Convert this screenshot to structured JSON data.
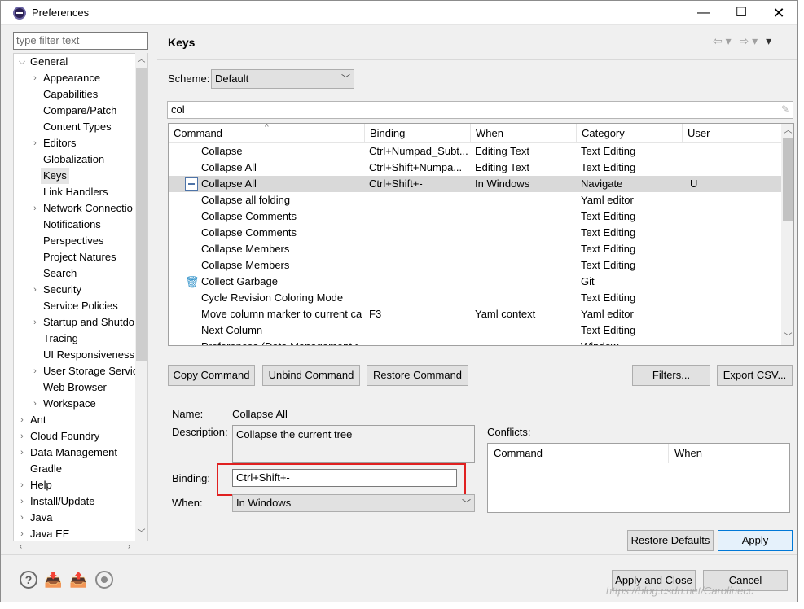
{
  "window": {
    "title": "Preferences",
    "minimize": "—",
    "maximize": "☐",
    "close": "✕"
  },
  "filter": {
    "placeholder": "type filter text"
  },
  "tree": {
    "items": [
      {
        "label": "General",
        "arrow": "⌵",
        "indent": 0
      },
      {
        "label": "Appearance",
        "arrow": "›",
        "indent": 1
      },
      {
        "label": "Capabilities",
        "arrow": "",
        "indent": 1
      },
      {
        "label": "Compare/Patch",
        "arrow": "",
        "indent": 1
      },
      {
        "label": "Content Types",
        "arrow": "",
        "indent": 1
      },
      {
        "label": "Editors",
        "arrow": "›",
        "indent": 1
      },
      {
        "label": "Globalization",
        "arrow": "",
        "indent": 1
      },
      {
        "label": "Keys",
        "arrow": "",
        "indent": 1
      },
      {
        "label": "Link Handlers",
        "arrow": "",
        "indent": 1
      },
      {
        "label": "Network Connectio",
        "arrow": "›",
        "indent": 1
      },
      {
        "label": "Notifications",
        "arrow": "",
        "indent": 1
      },
      {
        "label": "Perspectives",
        "arrow": "",
        "indent": 1
      },
      {
        "label": "Project Natures",
        "arrow": "",
        "indent": 1
      },
      {
        "label": "Search",
        "arrow": "",
        "indent": 1
      },
      {
        "label": "Security",
        "arrow": "›",
        "indent": 1
      },
      {
        "label": "Service Policies",
        "arrow": "",
        "indent": 1
      },
      {
        "label": "Startup and Shutdo",
        "arrow": "›",
        "indent": 1
      },
      {
        "label": "Tracing",
        "arrow": "",
        "indent": 1
      },
      {
        "label": "UI Responsiveness",
        "arrow": "",
        "indent": 1
      },
      {
        "label": "User Storage Servic",
        "arrow": "›",
        "indent": 1
      },
      {
        "label": "Web Browser",
        "arrow": "",
        "indent": 1
      },
      {
        "label": "Workspace",
        "arrow": "›",
        "indent": 1
      },
      {
        "label": "Ant",
        "arrow": "›",
        "indent": 0
      },
      {
        "label": "Cloud Foundry",
        "arrow": "›",
        "indent": 0
      },
      {
        "label": "Data Management",
        "arrow": "›",
        "indent": 0
      },
      {
        "label": "Gradle",
        "arrow": "",
        "indent": 0
      },
      {
        "label": "Help",
        "arrow": "›",
        "indent": 0
      },
      {
        "label": "Install/Update",
        "arrow": "›",
        "indent": 0
      },
      {
        "label": "Java",
        "arrow": "›",
        "indent": 0
      },
      {
        "label": "Java EE",
        "arrow": "›",
        "indent": 0
      }
    ],
    "selected": "Keys"
  },
  "page": {
    "title": "Keys",
    "nav_back": "⇦ ▾",
    "nav_forward": "⇨ ▾",
    "nav_menu": "▾"
  },
  "scheme": {
    "label": "Scheme:",
    "value": "Default"
  },
  "search": {
    "value": "col"
  },
  "table": {
    "columns": [
      "Command",
      "Binding",
      "When",
      "Category",
      "User"
    ],
    "rows": [
      {
        "command": "Collapse",
        "binding": "Ctrl+Numpad_Subt...",
        "when": "Editing Text",
        "category": "Text Editing",
        "user": "",
        "icon": ""
      },
      {
        "command": "Collapse All",
        "binding": "Ctrl+Shift+Numpa...",
        "when": "Editing Text",
        "category": "Text Editing",
        "user": "",
        "icon": ""
      },
      {
        "command": "Collapse All",
        "binding": "Ctrl+Shift+-",
        "when": "In Windows",
        "category": "Navigate",
        "user": "U",
        "icon": "collapse"
      },
      {
        "command": "Collapse all folding",
        "binding": "",
        "when": "",
        "category": "Yaml editor",
        "user": "",
        "icon": ""
      },
      {
        "command": "Collapse Comments",
        "binding": "",
        "when": "",
        "category": "Text Editing",
        "user": "",
        "icon": ""
      },
      {
        "command": "Collapse Comments",
        "binding": "",
        "when": "",
        "category": "Text Editing",
        "user": "",
        "icon": ""
      },
      {
        "command": "Collapse Members",
        "binding": "",
        "when": "",
        "category": "Text Editing",
        "user": "",
        "icon": ""
      },
      {
        "command": "Collapse Members",
        "binding": "",
        "when": "",
        "category": "Text Editing",
        "user": "",
        "icon": ""
      },
      {
        "command": "Collect Garbage",
        "binding": "",
        "when": "",
        "category": "Git",
        "user": "",
        "icon": "trash"
      },
      {
        "command": "Cycle Revision Coloring Mode",
        "binding": "",
        "when": "",
        "category": "Text Editing",
        "user": "",
        "icon": ""
      },
      {
        "command": "Move column marker to current ca",
        "binding": "F3",
        "when": "Yaml context",
        "category": "Yaml editor",
        "user": "",
        "icon": ""
      },
      {
        "command": "Next Column",
        "binding": "",
        "when": "",
        "category": "Text Editing",
        "user": "",
        "icon": ""
      },
      {
        "command": "Preferences (Data Management >",
        "binding": "",
        "when": "",
        "category": "Window",
        "user": "",
        "icon": ""
      }
    ],
    "selected_index": 2
  },
  "buttons": {
    "copy": "Copy Command",
    "unbind": "Unbind Command",
    "restore": "Restore Command",
    "filters": "Filters...",
    "export": "Export CSV...",
    "restore_defaults": "Restore Defaults",
    "apply": "Apply",
    "apply_close": "Apply and Close",
    "cancel": "Cancel"
  },
  "details": {
    "name_label": "Name:",
    "name_value": "Collapse All",
    "desc_label": "Description:",
    "desc_value": "Collapse the current tree",
    "binding_label": "Binding:",
    "binding_value": "Ctrl+Shift+-",
    "when_label": "When:",
    "when_value": "In Windows",
    "conflicts_label": "Conflicts:",
    "conflicts_columns": [
      "Command",
      "When"
    ]
  },
  "watermark": "https://blog.csdn.net/Carolinecc"
}
